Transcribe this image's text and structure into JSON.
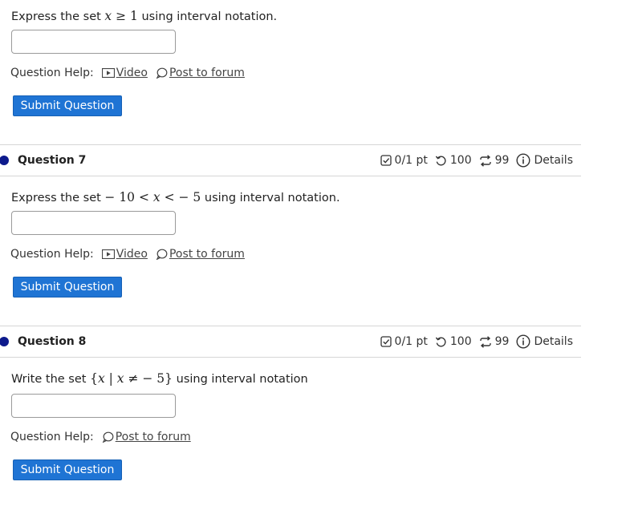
{
  "q6": {
    "prompt_pre": "Express the set ",
    "math_var": "x",
    "math_op": " ≥ ",
    "math_num": "1",
    "prompt_post": " using interval notation.",
    "answer_value": "",
    "help_label": "Question Help:",
    "video_label": "Video",
    "forum_label": "Post to forum",
    "submit_label": "Submit Question"
  },
  "q7": {
    "title": "Question 7",
    "score": "0/1 pt",
    "retries": "100",
    "attempts": "99",
    "details": "Details",
    "prompt_pre": "Express the set ",
    "math_a": "− 10 < ",
    "math_var": "x",
    "math_b": " <  − 5",
    "prompt_post": " using interval notation.",
    "answer_value": "",
    "help_label": "Question Help:",
    "video_label": "Video",
    "forum_label": "Post to forum",
    "submit_label": "Submit Question"
  },
  "q8": {
    "title": "Question 8",
    "score": "0/1 pt",
    "retries": "100",
    "attempts": "99",
    "details": "Details",
    "prompt_pre": "Write the set ",
    "math_open": "{",
    "math_var1": "x",
    "math_bar": " | ",
    "math_var2": "x",
    "math_rest": " ≠  − 5",
    "math_close": "}",
    "prompt_post": " using interval notation",
    "answer_value": "",
    "help_label": "Question Help:",
    "forum_label": "Post to forum",
    "submit_label": "Submit Question"
  },
  "colors": {
    "submit_bg": "#1f74d4",
    "status_dot": "#0d1a8c",
    "divider": "#d6d6d6"
  },
  "icons": [
    "video-icon",
    "forum-icon",
    "score-check-icon",
    "retry-icon",
    "attempts-icon",
    "info-icon",
    "status-dot"
  ]
}
